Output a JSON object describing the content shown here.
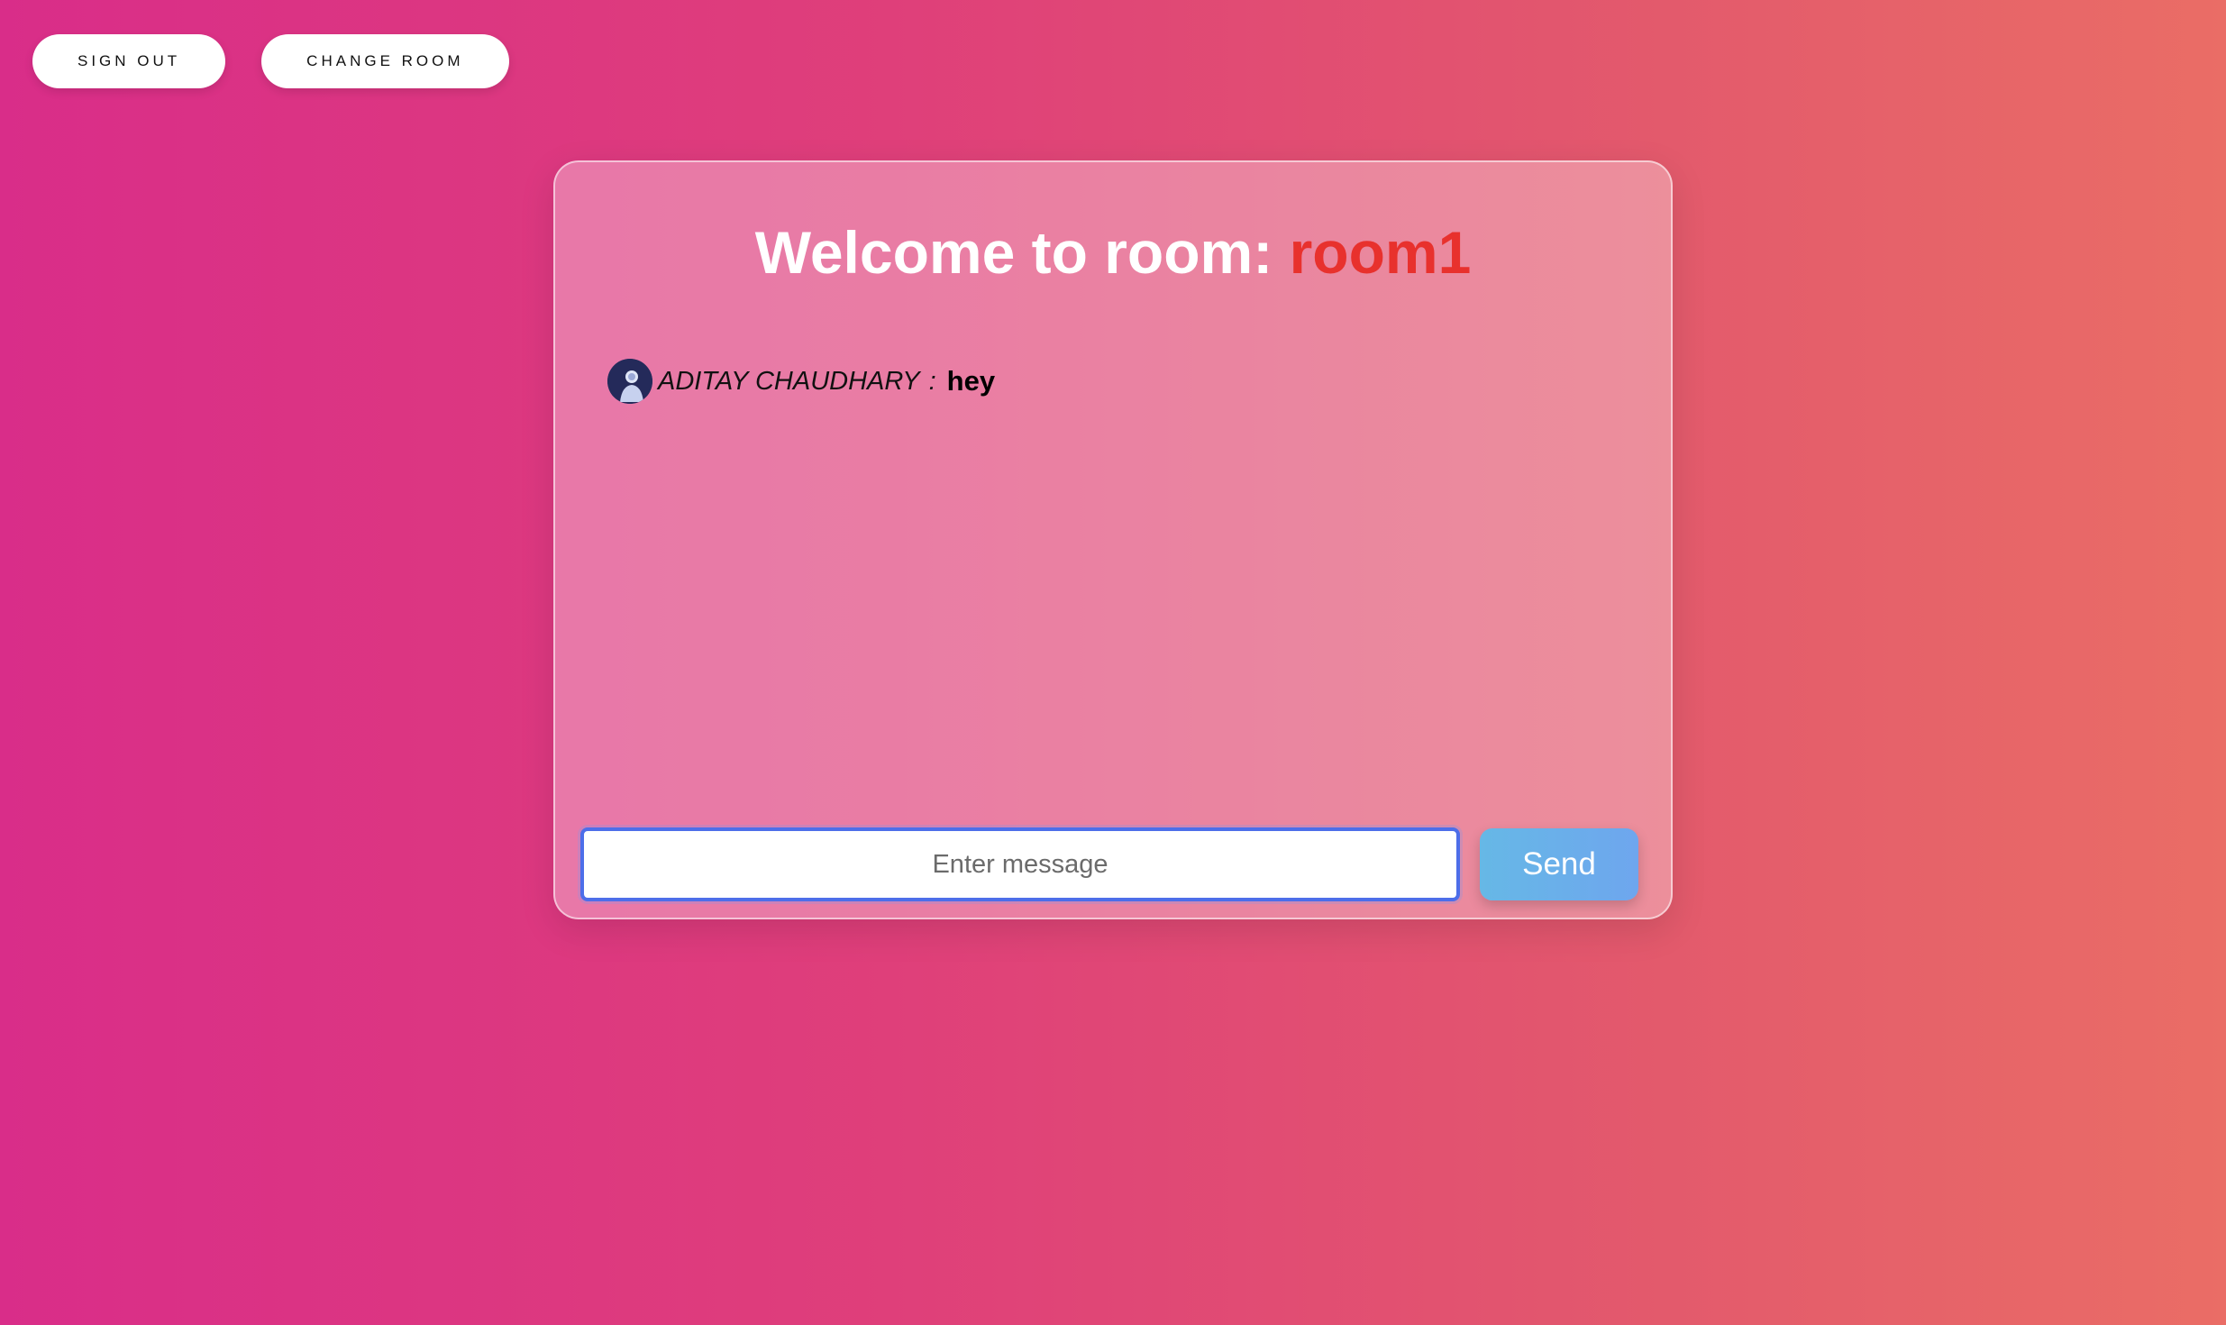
{
  "topbar": {
    "sign_out_label": "SIGN OUT",
    "change_room_label": "CHANGE ROOM"
  },
  "chat": {
    "title_prefix": "Welcome to room: ",
    "room_name": "room1",
    "messages": [
      {
        "avatar_icon": "user-avatar-icon",
        "sender": "ADITAY CHAUDHARY",
        "separator": ":",
        "text": "hey"
      }
    ],
    "composer": {
      "input_value": "",
      "input_placeholder": "Enter message",
      "send_label": "Send"
    }
  },
  "colors": {
    "room_name": "#e8312d",
    "send_button": "#6ab0ea",
    "input_border": "#4d6ee9"
  }
}
